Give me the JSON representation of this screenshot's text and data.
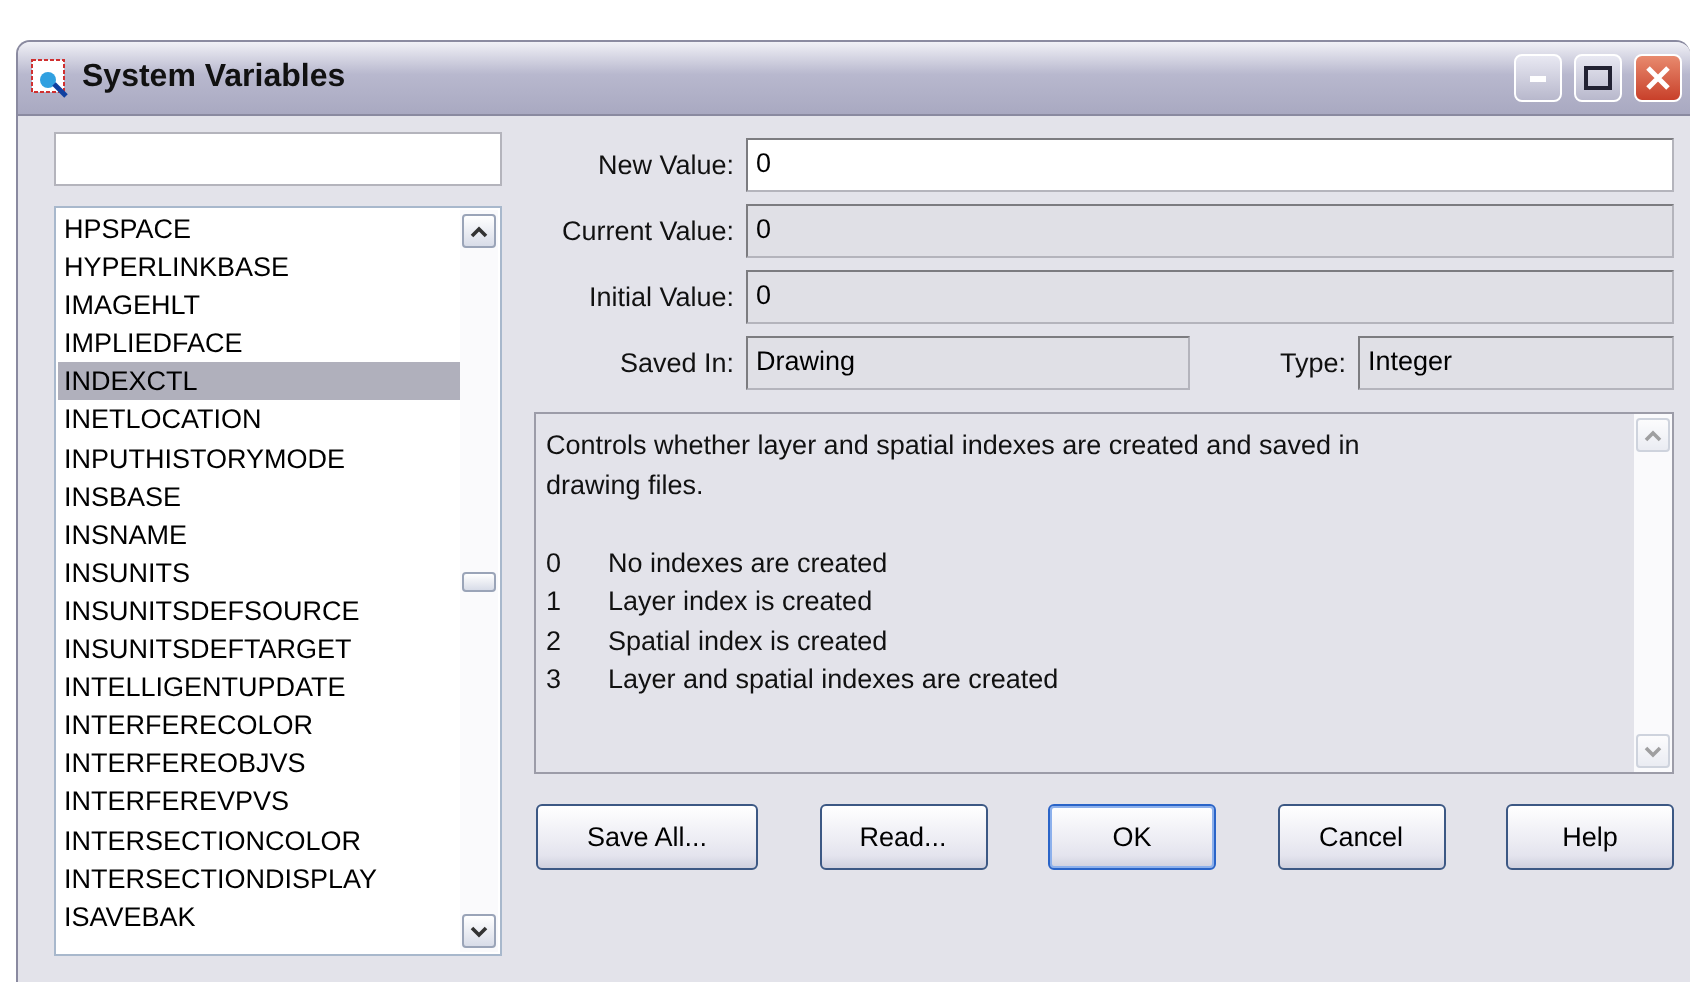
{
  "window": {
    "title": "System Variables"
  },
  "variables": [
    {
      "name": "HPSPACE",
      "selected": false
    },
    {
      "name": "HYPERLINKBASE",
      "selected": false
    },
    {
      "name": "IMAGEHLT",
      "selected": false
    },
    {
      "name": "IMPLIEDFACE",
      "selected": false
    },
    {
      "name": "INDEXCTL",
      "selected": true
    },
    {
      "name": "INETLOCATION",
      "selected": false
    },
    {
      "name": "INPUTHISTORYMODE",
      "selected": false
    },
    {
      "name": "INSBASE",
      "selected": false
    },
    {
      "name": "INSNAME",
      "selected": false
    },
    {
      "name": "INSUNITS",
      "selected": false
    },
    {
      "name": "INSUNITSDEFSOURCE",
      "selected": false
    },
    {
      "name": "INSUNITSDEFTARGET",
      "selected": false
    },
    {
      "name": "INTELLIGENTUPDATE",
      "selected": false
    },
    {
      "name": "INTERFERECOLOR",
      "selected": false
    },
    {
      "name": "INTERFEREOBJVS",
      "selected": false
    },
    {
      "name": "INTERFEREVPVS",
      "selected": false
    },
    {
      "name": "INTERSECTIONCOLOR",
      "selected": false
    },
    {
      "name": "INTERSECTIONDISPLAY",
      "selected": false
    },
    {
      "name": "ISAVEBAK",
      "selected": false
    }
  ],
  "fields": [
    {
      "label": "New Value:",
      "value": "0",
      "readonly": false
    },
    {
      "label": "Current Value:",
      "value": "0",
      "readonly": true
    },
    {
      "label": "Initial Value:",
      "value": "0",
      "readonly": true
    }
  ],
  "saved_in": {
    "label": "Saved In:",
    "value": "Drawing",
    "readonly": true
  },
  "type": {
    "label": "Type:",
    "value": "Integer",
    "readonly": true
  },
  "description": {
    "text": "Controls whether layer and spatial indexes are created and saved in drawing files.",
    "options": [
      {
        "code": "0",
        "text": "No indexes are created"
      },
      {
        "code": "1",
        "text": "Layer index is created"
      },
      {
        "code": "2",
        "text": "Spatial index is created"
      },
      {
        "code": "3",
        "text": "Layer and spatial indexes are created"
      }
    ]
  },
  "buttons": [
    {
      "label": "Save All...",
      "default": false
    },
    {
      "label": "Read...",
      "default": false
    },
    {
      "label": "OK",
      "default": true
    },
    {
      "label": "Cancel",
      "default": false
    },
    {
      "label": "Help",
      "default": false
    }
  ]
}
